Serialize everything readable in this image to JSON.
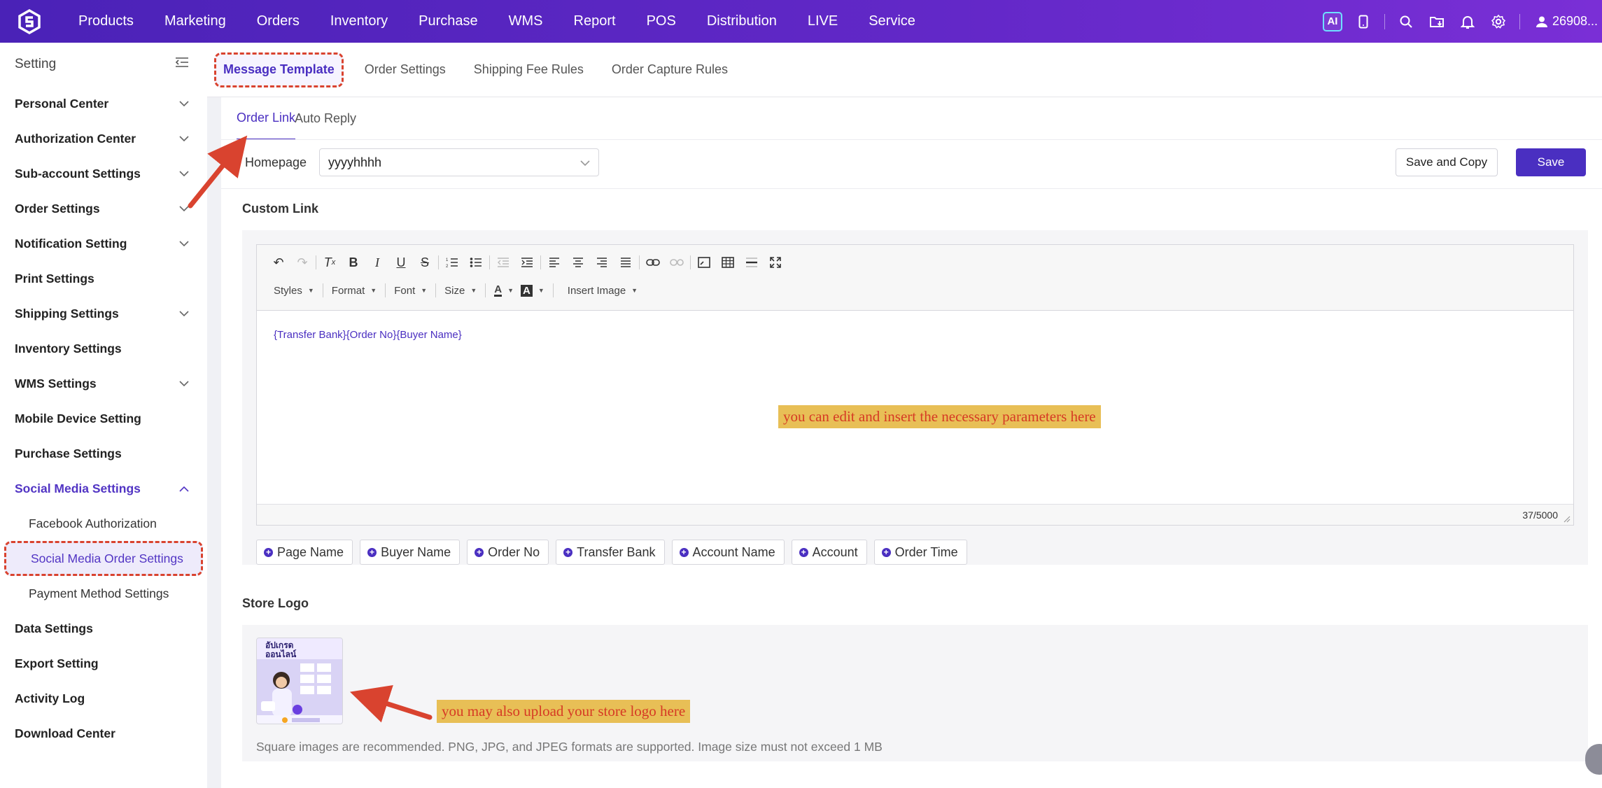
{
  "topbar": {
    "nav": [
      "Products",
      "Marketing",
      "Orders",
      "Inventory",
      "Purchase",
      "WMS",
      "Report",
      "POS",
      "Distribution",
      "LIVE",
      "Service"
    ],
    "ai_label": "AI",
    "user_label": "26908..."
  },
  "sidebar": {
    "title": "Setting",
    "items": [
      {
        "label": "Personal Center",
        "chevron": "down"
      },
      {
        "label": "Authorization Center",
        "chevron": "down"
      },
      {
        "label": "Sub-account Settings",
        "chevron": "down"
      },
      {
        "label": "Order Settings",
        "chevron": "down"
      },
      {
        "label": "Notification Setting",
        "chevron": "down"
      },
      {
        "label": "Print Settings",
        "chevron": ""
      },
      {
        "label": "Shipping Settings",
        "chevron": "down"
      },
      {
        "label": "Inventory Settings",
        "chevron": ""
      },
      {
        "label": "WMS Settings",
        "chevron": "down"
      },
      {
        "label": "Mobile Device Setting",
        "chevron": ""
      },
      {
        "label": "Purchase Settings",
        "chevron": ""
      },
      {
        "label": "Social Media Settings",
        "chevron": "up",
        "active": true
      },
      {
        "label": "Facebook Authorization",
        "sub": true
      },
      {
        "label": "Social Media Order Settings",
        "sub": true,
        "selected": true
      },
      {
        "label": "Payment Method Settings",
        "sub": true
      },
      {
        "label": "Data Settings",
        "chevron": ""
      },
      {
        "label": "Export Setting",
        "chevron": ""
      },
      {
        "label": "Activity Log",
        "chevron": ""
      },
      {
        "label": "Download Center",
        "chevron": ""
      }
    ]
  },
  "tabs": [
    "Message Template",
    "Order Settings",
    "Shipping Fee Rules",
    "Order Capture Rules"
  ],
  "subtabs": [
    "Order Link",
    "Auto Reply"
  ],
  "homepage": {
    "required_mark": "*",
    "label": "Homepage",
    "value": "yyyyhhhh"
  },
  "buttons": {
    "save_copy": "Save and Copy",
    "save": "Save"
  },
  "custom_link": {
    "title": "Custom Link",
    "toolbar_dropdowns": [
      "Styles",
      "Format",
      "Font",
      "Size"
    ],
    "insert_image": "Insert Image",
    "content": "{Transfer Bank}{Order No}{Buyer Name}",
    "counter": "37/5000",
    "annotation": "you can edit and insert the necessary parameters here",
    "params": [
      "Page Name",
      "Buyer Name",
      "Order No",
      "Transfer Bank",
      "Account Name",
      "Account",
      "Order Time"
    ]
  },
  "store_logo": {
    "title": "Store Logo",
    "annotation": "you may also upload your store logo here",
    "hint": "Square images are recommended. PNG, JPG, and JPEG formats are supported. Image size must not exceed 1 MB",
    "thumb_text": "อัปเกรด ออนไลน์"
  },
  "colors": {
    "brand": "#4a2fc1",
    "annotation_bg": "#e8bf56",
    "annotation_text": "#d63a24",
    "highlight_border": "#d9432f"
  }
}
